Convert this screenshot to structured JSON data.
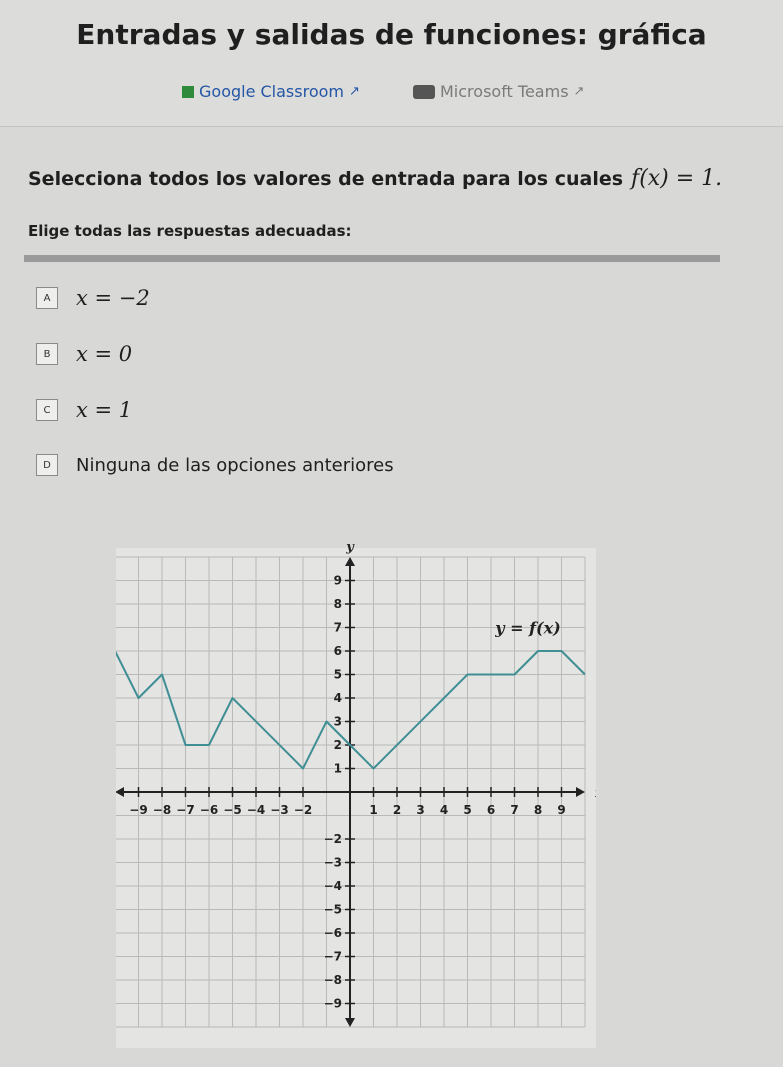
{
  "page": {
    "title": "Entradas y salidas de funciones: gráfica",
    "share_links": [
      {
        "label": "Google Classroom",
        "icon": "google-classroom-icon"
      },
      {
        "label": "Microsoft Teams",
        "icon": "microsoft-teams-icon"
      }
    ]
  },
  "question": {
    "text": "Selecciona todos los valores de entrada para los cuales",
    "math": "f(x) = 1.",
    "instruction": "Elige todas las respuestas adecuadas:"
  },
  "options": [
    {
      "letter": "A",
      "text": "x = −2",
      "math": true
    },
    {
      "letter": "B",
      "text": "x = 0",
      "math": true
    },
    {
      "letter": "C",
      "text": "x = 1",
      "math": true
    },
    {
      "letter": "D",
      "text": "Ninguna de las opciones anteriores",
      "math": false
    }
  ],
  "chart_data": {
    "type": "line",
    "xlabel": "x",
    "ylabel": "y",
    "xlim": [
      -10,
      10
    ],
    "ylim": [
      -10,
      10
    ],
    "grid": true,
    "x_tick_labels": [
      "−9",
      "−8",
      "−7",
      "−6",
      "−5",
      "−4",
      "−3",
      "−2",
      "1",
      "2",
      "3",
      "4",
      "5",
      "6",
      "7",
      "8",
      "9"
    ],
    "y_tick_labels": [
      "9",
      "8",
      "7",
      "6",
      "5",
      "4",
      "3",
      "2",
      "1",
      "−2",
      "−3",
      "−4",
      "−5",
      "−6",
      "−7",
      "−8",
      "−9"
    ],
    "series": [
      {
        "name": "y = f(x)",
        "color": "#3f8f95",
        "points": [
          [
            -10,
            6
          ],
          [
            -9,
            4
          ],
          [
            -8,
            5
          ],
          [
            -7,
            2
          ],
          [
            -6,
            2
          ],
          [
            -5,
            4
          ],
          [
            -2,
            1
          ],
          [
            -1,
            3
          ],
          [
            0,
            2
          ],
          [
            1,
            1
          ],
          [
            5,
            5
          ],
          [
            7,
            5
          ],
          [
            8,
            6
          ],
          [
            9,
            6
          ],
          [
            10,
            5
          ]
        ]
      }
    ],
    "annotation": "y = f(x)"
  }
}
